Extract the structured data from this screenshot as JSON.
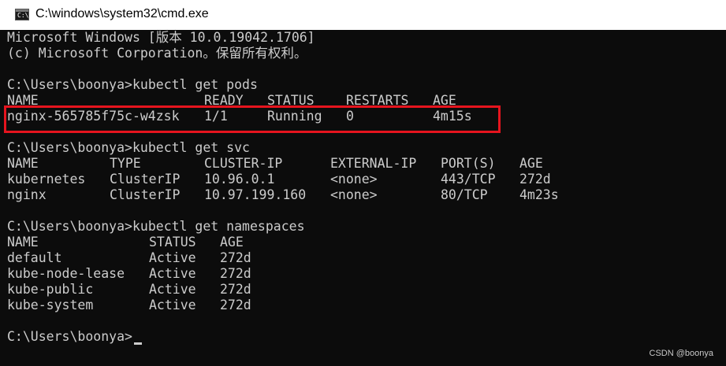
{
  "window": {
    "title": "C:\\windows\\system32\\cmd.exe",
    "icon": "cmd-icon",
    "icon_glyph": "C:\\."
  },
  "console": {
    "header": {
      "version_line": "Microsoft Windows [版本 10.0.19042.1706]",
      "copyright_line": "(c) Microsoft Corporation。保留所有权利。"
    },
    "prompt": "C:\\Users\\boonya>",
    "pods": {
      "command": "kubectl get pods",
      "headers": [
        "NAME",
        "READY",
        "STATUS",
        "RESTARTS",
        "AGE"
      ],
      "rows": [
        [
          "nginx-565785f75c-w4zsk",
          "1/1",
          "Running",
          "0",
          "4m15s"
        ]
      ]
    },
    "svc": {
      "command": "kubectl get svc",
      "headers": [
        "NAME",
        "TYPE",
        "CLUSTER-IP",
        "EXTERNAL-IP",
        "PORT(S)",
        "AGE"
      ],
      "rows": [
        [
          "kubernetes",
          "ClusterIP",
          "10.96.0.1",
          "<none>",
          "443/TCP",
          "272d"
        ],
        [
          "nginx",
          "ClusterIP",
          "10.97.199.160",
          "<none>",
          "80/TCP",
          "4m23s"
        ]
      ]
    },
    "namespaces": {
      "command": "kubectl get namespaces",
      "headers": [
        "NAME",
        "STATUS",
        "AGE"
      ],
      "rows": [
        [
          "default",
          "Active",
          "272d"
        ],
        [
          "kube-node-lease",
          "Active",
          "272d"
        ],
        [
          "kube-public",
          "Active",
          "272d"
        ],
        [
          "kube-system",
          "Active",
          "272d"
        ]
      ]
    }
  },
  "watermark": "CSDN @boonya",
  "colors": {
    "console_bg": "#0c0c0c",
    "console_text": "#cccccc",
    "highlight_border": "#e6141e",
    "titlebar_bg": "#ffffff"
  }
}
